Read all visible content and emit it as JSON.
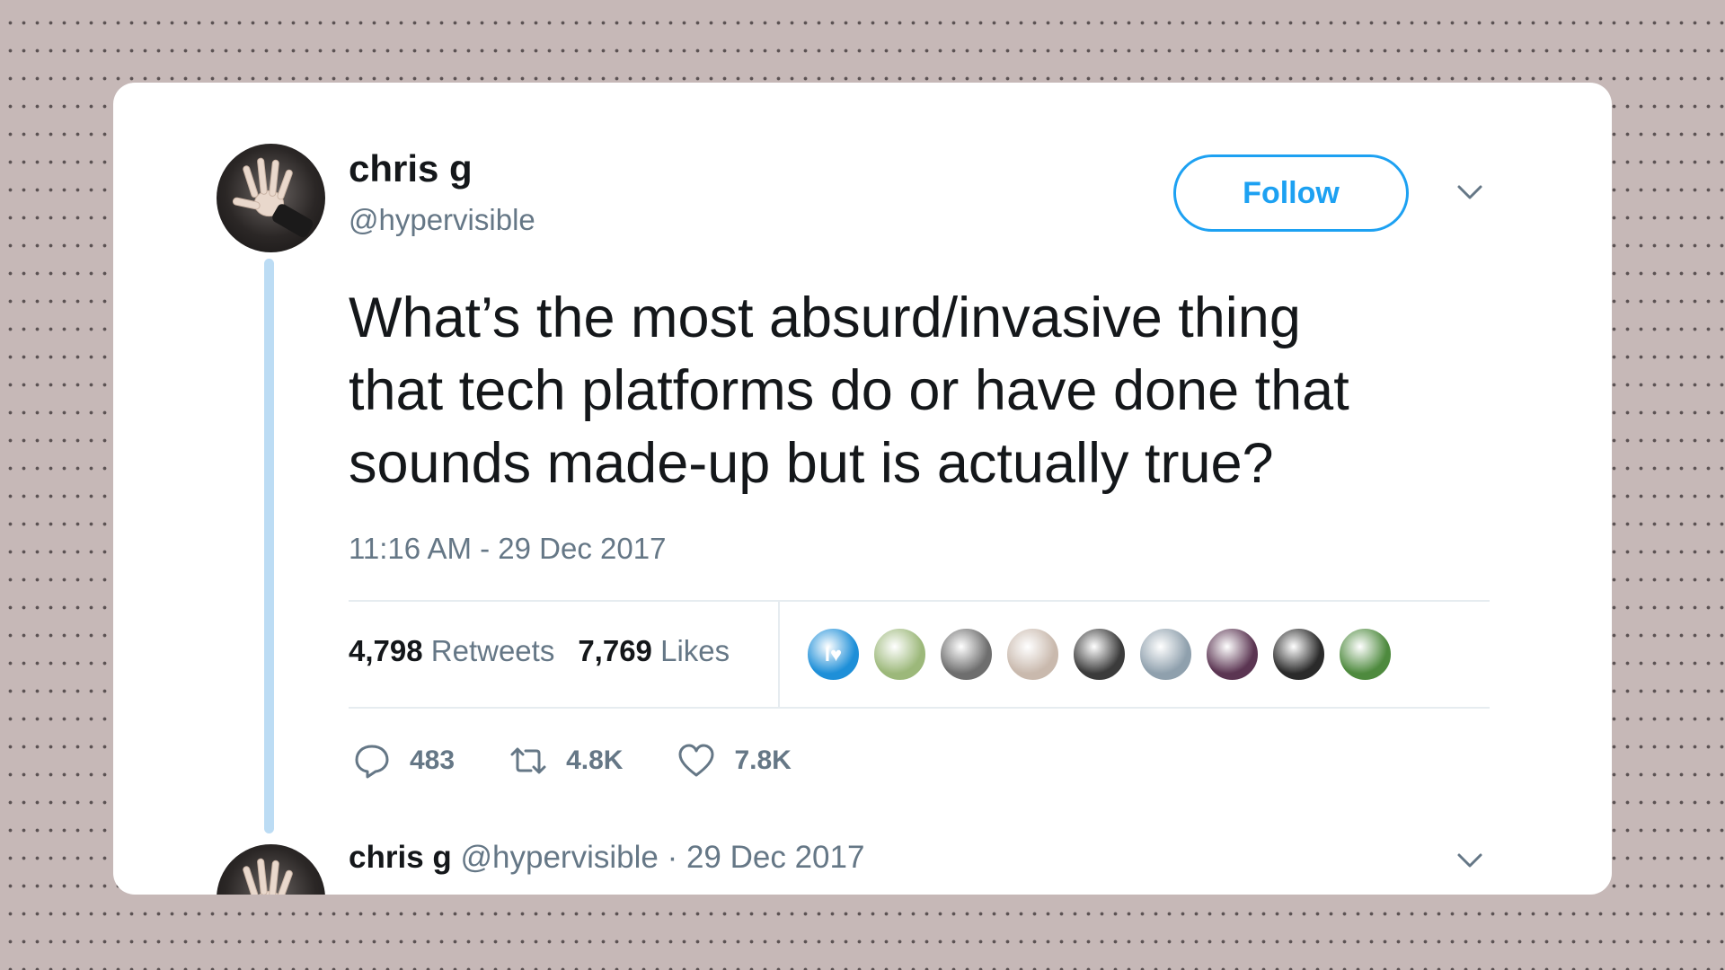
{
  "tweet": {
    "author_name": "chris g",
    "author_handle": "@hypervisible",
    "follow_label": "Follow",
    "text_lines": [
      "What’s the most absurd/invasive thing",
      "that tech platforms do or have done that",
      "sounds made-up but is actually true?"
    ],
    "timestamp": "11:16 AM - 29 Dec 2017",
    "retweets_count": "4,798",
    "retweets_label": "Retweets",
    "likes_count": "7,769",
    "likes_label": "Likes",
    "likers": [
      {
        "icon": "i-love-users-avatar",
        "glyph": "I♥",
        "color": "#1e8fd8"
      },
      {
        "icon": "cartoon-avatar",
        "color": "#9cb87a"
      },
      {
        "icon": "bald-man-avatar",
        "color": "#6e6e6e"
      },
      {
        "icon": "man-portrait-avatar",
        "color": "#c9b9ad"
      },
      {
        "icon": "dark-figure-avatar",
        "color": "#3b3b3b"
      },
      {
        "icon": "couple-avatar",
        "color": "#8fa0ad"
      },
      {
        "icon": "group-avatar",
        "color": "#5b3552"
      },
      {
        "icon": "bw-woman-avatar",
        "color": "#2a2a2a"
      },
      {
        "icon": "colorful-art-avatar",
        "color": "#4e8a3e"
      }
    ],
    "actions": {
      "reply_count": "483",
      "retweet_count": "4.8K",
      "like_count": "7.8K"
    }
  },
  "reply": {
    "author_name": "chris g",
    "author_handle": "@hypervisible",
    "date": "· 29 Dec 2017"
  },
  "colors": {
    "accent": "#1da1f2",
    "thread_line": "#bcdcf4",
    "muted": "#657786",
    "text": "#14171a"
  }
}
